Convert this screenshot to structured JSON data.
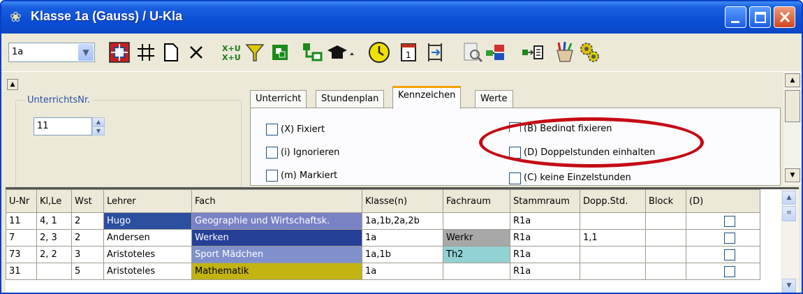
{
  "window": {
    "title": "Klasse 1a (Gauss) / U-Kla"
  },
  "toolbar": {
    "class_select_value": "1a",
    "icons": [
      "view-icon",
      "grid-icon",
      "new-icon",
      "delete-icon",
      "swap-icon",
      "filter-icon",
      "split-icon",
      "link-icon",
      "hat-icon",
      "clock-icon",
      "calendar-icon",
      "columns-icon",
      "search-icon",
      "rooms-icon",
      "export-icon",
      "paint-icon",
      "gears-icon"
    ]
  },
  "top_pane": {
    "group_label": "UnterrichtsNr.",
    "unterricht_nr": "11",
    "tabs": [
      "Unterricht",
      "Stundenplan",
      "Kennzeichen",
      "Werte"
    ],
    "active_tab": "Kennzeichen",
    "checkboxes_left": [
      "(X) Fixiert",
      "(i) Ignorieren",
      "(m) Markiert"
    ],
    "checkboxes_right": [
      "(B) Bedingt fixieren",
      "(D) Doppelstunden einhalten",
      "(C) keine Einzelstunden"
    ]
  },
  "table": {
    "columns": [
      "U-Nr",
      "Kl,Le",
      "Wst",
      "Lehrer",
      "Fach",
      "Klasse(n)",
      "Fachraum",
      "Stammraum",
      "Dopp.Std.",
      "Block",
      "(D)"
    ],
    "rows": [
      {
        "unr": "11",
        "klle": "4, 1",
        "wst": "2",
        "lehrer": "Hugo",
        "fach": "Geographie und Wirtschaftsk.",
        "klassen": "1a,1b,2a,2b",
        "fachraum": "",
        "stammraum": "R1a",
        "dopp": "",
        "block": "",
        "lehrer_bg": "#2c4f9f",
        "fach_bg": "#7a82c6",
        "fachraum_bg": ""
      },
      {
        "unr": "7",
        "klle": "2, 3",
        "wst": "2",
        "lehrer": "Andersen",
        "fach": "Werken",
        "klassen": "1a",
        "fachraum": "Werkr",
        "stammraum": "R1a",
        "dopp": "1,1",
        "block": "",
        "lehrer_bg": "",
        "fach_bg": "#263f97",
        "fachraum_bg": "#a8a8a8"
      },
      {
        "unr": "73",
        "klle": "2, 2",
        "wst": "3",
        "lehrer": "Aristoteles",
        "fach": "Sport Mädchen",
        "klassen": "1a,1b",
        "fachraum": "Th2",
        "stammraum": "R1a",
        "dopp": "",
        "block": "",
        "lehrer_bg": "",
        "fach_bg": "#8090cc",
        "fachraum_bg": "#93d2d4"
      },
      {
        "unr": "31",
        "klle": "",
        "wst": "5",
        "lehrer": "Aristoteles",
        "fach": "Mathematik",
        "klassen": "1a",
        "fachraum": "",
        "stammraum": "R1a",
        "dopp": "",
        "block": "",
        "lehrer_bg": "",
        "fach_bg": "#c2b313",
        "fachraum_bg": ""
      }
    ]
  }
}
